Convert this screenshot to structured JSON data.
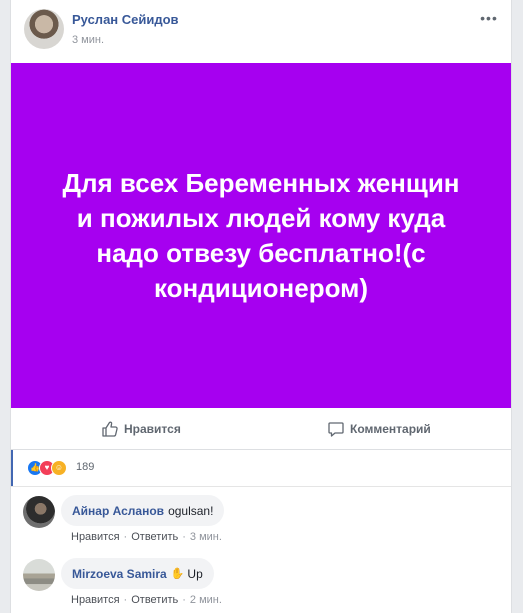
{
  "post": {
    "author": "Руслан Сейидов",
    "timestamp": "3 мин.",
    "more_icon": "more-dots-icon",
    "text": "Для всех Беременных женщин и пожилых людей кому куда надо отвезу бесплатно!(с кондиционером)",
    "background_color": "#a600f0"
  },
  "actions": {
    "like_label": "Нравится",
    "comment_label": "Комментарий"
  },
  "reactions": {
    "icons": [
      "like-icon",
      "love-icon",
      "haha-icon"
    ],
    "count": "189"
  },
  "comments": [
    {
      "author": "Айнар Асланов",
      "text": "ogulsan!",
      "like_label": "Нравится",
      "reply_label": "Ответить",
      "time": "3 мин."
    },
    {
      "author": "Mirzoeva Samira",
      "emoji": "waving-hand-icon",
      "text": "Up",
      "like_label": "Нравится",
      "reply_label": "Ответить",
      "time": "2 мин."
    }
  ]
}
